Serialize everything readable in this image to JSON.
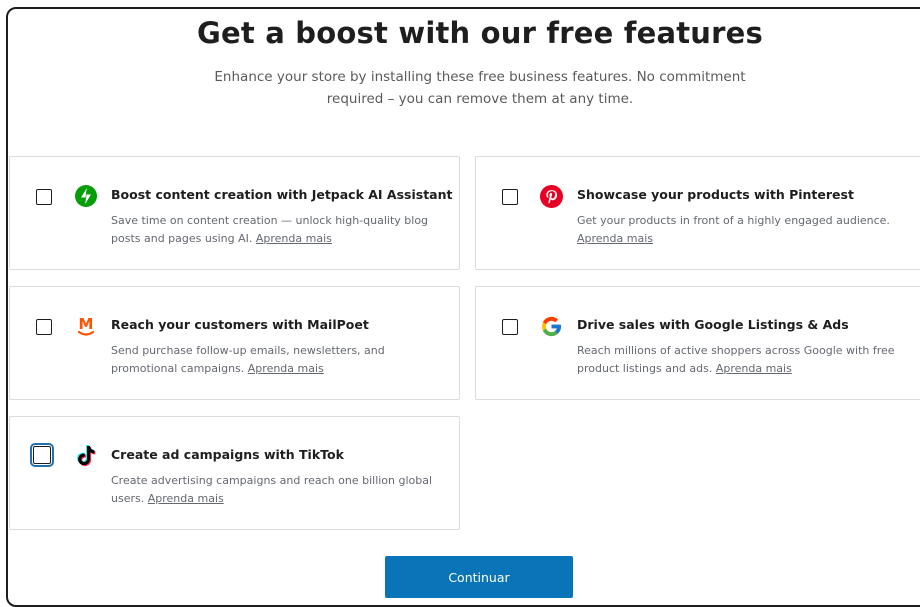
{
  "header": {
    "title": "Get a boost with our free features",
    "subtitle": "Enhance your store by installing these free business features. No commitment required – you can remove them at any time."
  },
  "features": [
    {
      "title": "Boost content creation with Jetpack AI Assistant",
      "description": "Save time on content creation — unlock high-quality blog posts and pages using AI.",
      "link": "Aprenda mais",
      "icon": "jetpack-icon",
      "checked": false
    },
    {
      "title": "Showcase your products with Pinterest",
      "description": "Get your products in front of a highly engaged audience.",
      "link": "Aprenda mais",
      "icon": "pinterest-icon",
      "checked": false
    },
    {
      "title": "Reach your customers with MailPoet",
      "description": "Send purchase follow-up emails, newsletters, and promotional campaigns.",
      "link": "Aprenda mais",
      "icon": "mailpoet-icon",
      "checked": false
    },
    {
      "title": "Drive sales with Google Listings & Ads",
      "description": "Reach millions of active shoppers across Google with free product listings and ads.",
      "link": "Aprenda mais",
      "icon": "google-icon",
      "checked": false
    },
    {
      "title": "Create ad campaigns with TikTok",
      "description": "Create advertising campaigns and reach one billion global users.",
      "link": "Aprenda mais",
      "icon": "tiktok-icon",
      "checked": false
    }
  ],
  "actions": {
    "continue_label": "Continuar"
  },
  "colors": {
    "jetpack": "#069e08",
    "pinterest": "#e60023",
    "mailpoet": "#fe5301",
    "primary_button": "#0a74b8"
  }
}
